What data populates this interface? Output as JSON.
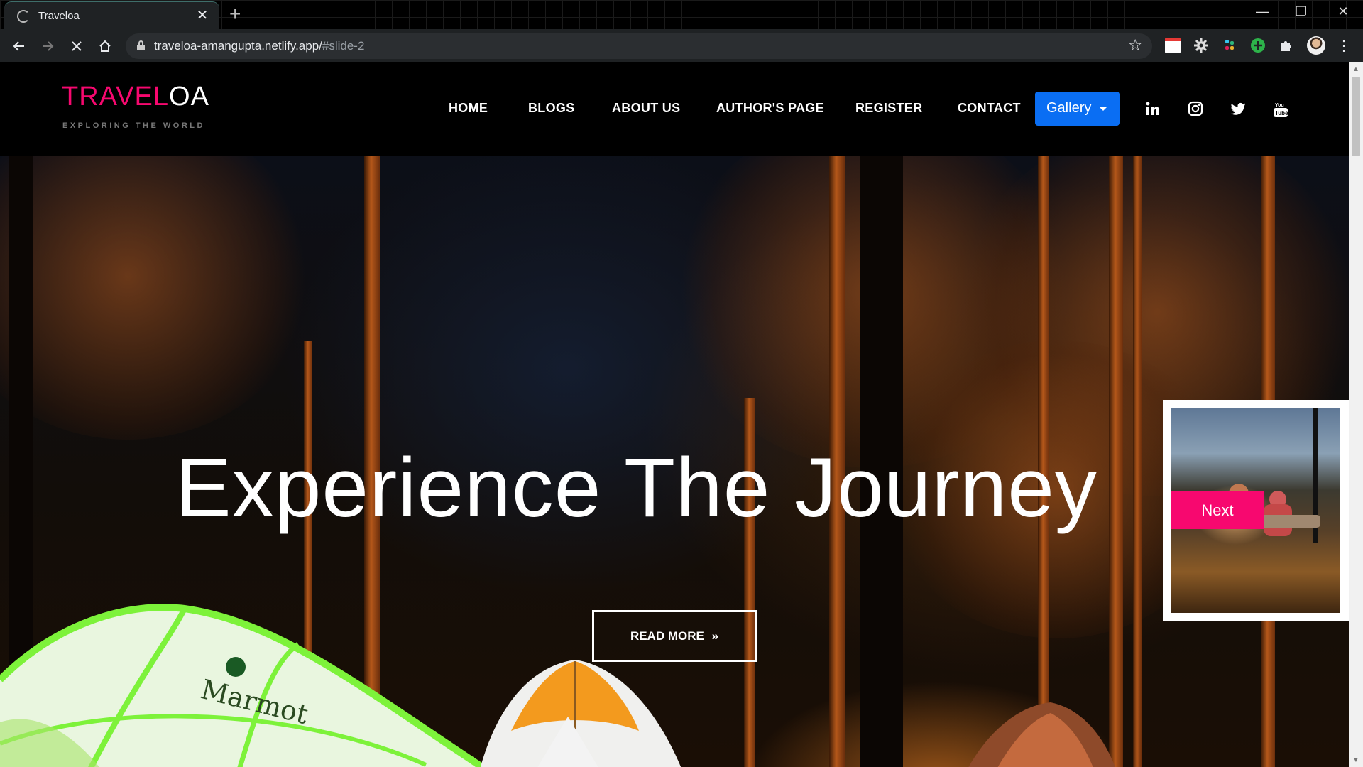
{
  "browser": {
    "tab_title": "Traveloa",
    "tab_close": "✕",
    "new_tab": "+",
    "url_host": "traveloa-amangupta.netlify.app/",
    "url_path": "#slide-2",
    "window_minimize": "—",
    "window_restore": "❐",
    "window_close": "✕"
  },
  "site": {
    "logo_pink": "TRAVEL",
    "logo_white": "OA",
    "tagline": "EXPLORING THE WORLD",
    "nav": {
      "home": "HOME",
      "blogs": "BLOGS",
      "about": "ABOUT US",
      "author": "AUTHOR'S PAGE",
      "register": "REGISTER",
      "contact": "CONTACT",
      "gallery": "Gallery"
    },
    "social": [
      "linkedin-icon",
      "instagram-icon",
      "twitter-icon",
      "youtube-icon"
    ],
    "accent_color": "#f7086f",
    "gallery_color": "#0a6ef3"
  },
  "hero": {
    "headline": "Experience The Journey",
    "read_more": "READ MORE",
    "read_more_icon": "»",
    "next_label": "Next",
    "tent_brand": "Marmot"
  }
}
